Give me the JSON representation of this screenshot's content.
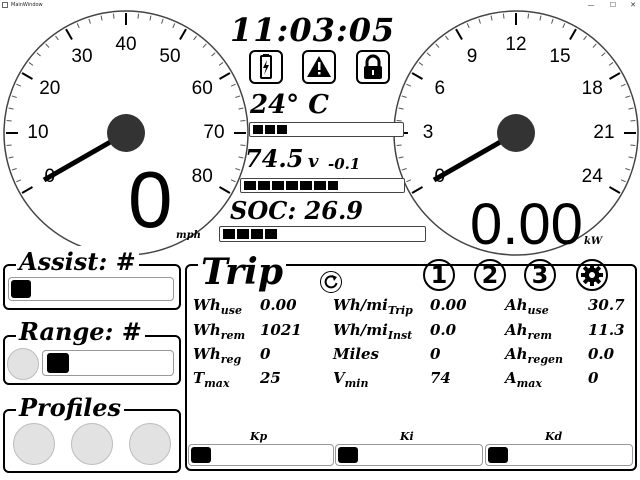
{
  "window": {
    "title": "MainWindow",
    "minimize": "—",
    "maximize": "☐",
    "close": "✕"
  },
  "speedometer": {
    "ticks": [
      "0",
      "10",
      "20",
      "30",
      "40",
      "50",
      "60",
      "70",
      "80"
    ],
    "value": "0",
    "unit": "mph"
  },
  "power_gauge": {
    "ticks": [
      "0",
      "3",
      "6",
      "9",
      "12",
      "15",
      "18",
      "21",
      "24"
    ],
    "value": "0.00",
    "unit": "kW"
  },
  "clock": "11:03:05",
  "status_icons": [
    "battery-icon",
    "warning-icon",
    "lock-icon"
  ],
  "temperature": {
    "value": "24° C",
    "level_fraction": 0.25
  },
  "voltage": {
    "value": "74.5",
    "unit": "v",
    "delta": "-0.1",
    "level_fraction": 0.6
  },
  "soc": {
    "label": "SOC: 26.9",
    "level_fraction": 0.27
  },
  "assist": {
    "label": "Assist: #",
    "level_fraction": 0.0
  },
  "range": {
    "label": "Range: #",
    "level_fraction": 0.0
  },
  "profiles": {
    "label": "Profiles",
    "count": 3
  },
  "trip": {
    "title": "Trip",
    "refresh_icon": "refresh-icon",
    "trip_buttons": [
      "1",
      "2",
      "3"
    ],
    "settings_icon": "gear-icon",
    "rows": [
      [
        {
          "label": "Wh",
          "sub": "use",
          "value": "0.00"
        },
        {
          "label": "Wh/mi",
          "sub": "Trip",
          "value": "0.00"
        },
        {
          "label": "Ah",
          "sub": "use",
          "value": "30.7"
        }
      ],
      [
        {
          "label": "Wh",
          "sub": "rem",
          "value": "1021"
        },
        {
          "label": "Wh/mi",
          "sub": "Inst",
          "value": "0.0"
        },
        {
          "label": "Ah",
          "sub": "rem",
          "value": "11.3"
        }
      ],
      [
        {
          "label": "Wh",
          "sub": "reg",
          "value": "0"
        },
        {
          "label": "Miles",
          "sub": "",
          "value": "0"
        },
        {
          "label": "Ah",
          "sub": "regen",
          "value": "0.0"
        }
      ],
      [
        {
          "label": "T",
          "sub": "max",
          "value": "25"
        },
        {
          "label": "V",
          "sub": "min",
          "value": "74"
        },
        {
          "label": "A",
          "sub": "max",
          "value": "0"
        }
      ]
    ],
    "pid": [
      {
        "label": "Kp"
      },
      {
        "label": "Ki"
      },
      {
        "label": "Kd"
      }
    ]
  }
}
